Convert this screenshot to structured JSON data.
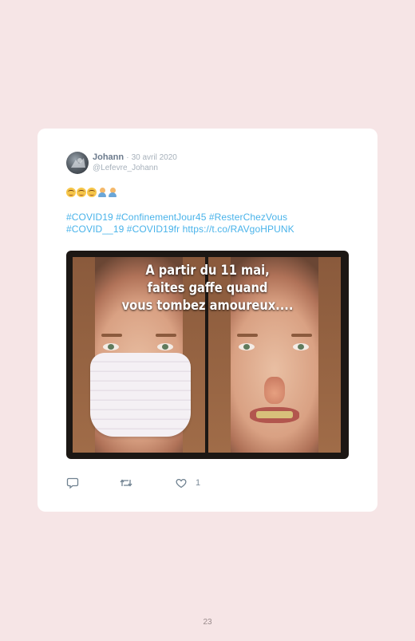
{
  "tweet": {
    "author_name": "Johann",
    "separator": "·",
    "date": "30 avril 2020",
    "handle": "@Lefevre_Johann",
    "text_line1": "#COVID19 #ConfinementJour45 #ResterChezVous",
    "text_line2": "#COVID__19 #COVID19fr https://t.co/RAVgoHPUNK",
    "emoji": [
      "smiling-face-icon",
      "smiling-face-icon",
      "smiling-face-icon",
      "person-shrugging-icon",
      "person-shrugging-icon"
    ]
  },
  "media": {
    "caption_line1": "A partir du 11 mai,",
    "caption_line2": "faites gaffe quand",
    "caption_line3": "vous tombez amoureux...."
  },
  "actions": {
    "reply_icon": "reply-icon",
    "retweet_icon": "retweet-icon",
    "like_icon": "heart-icon",
    "like_count": "1"
  },
  "page": {
    "number": "23"
  },
  "colors": {
    "background": "#f6e5e6",
    "card": "#ffffff",
    "link": "#49b3ea",
    "meta": "#a7b1bb"
  }
}
